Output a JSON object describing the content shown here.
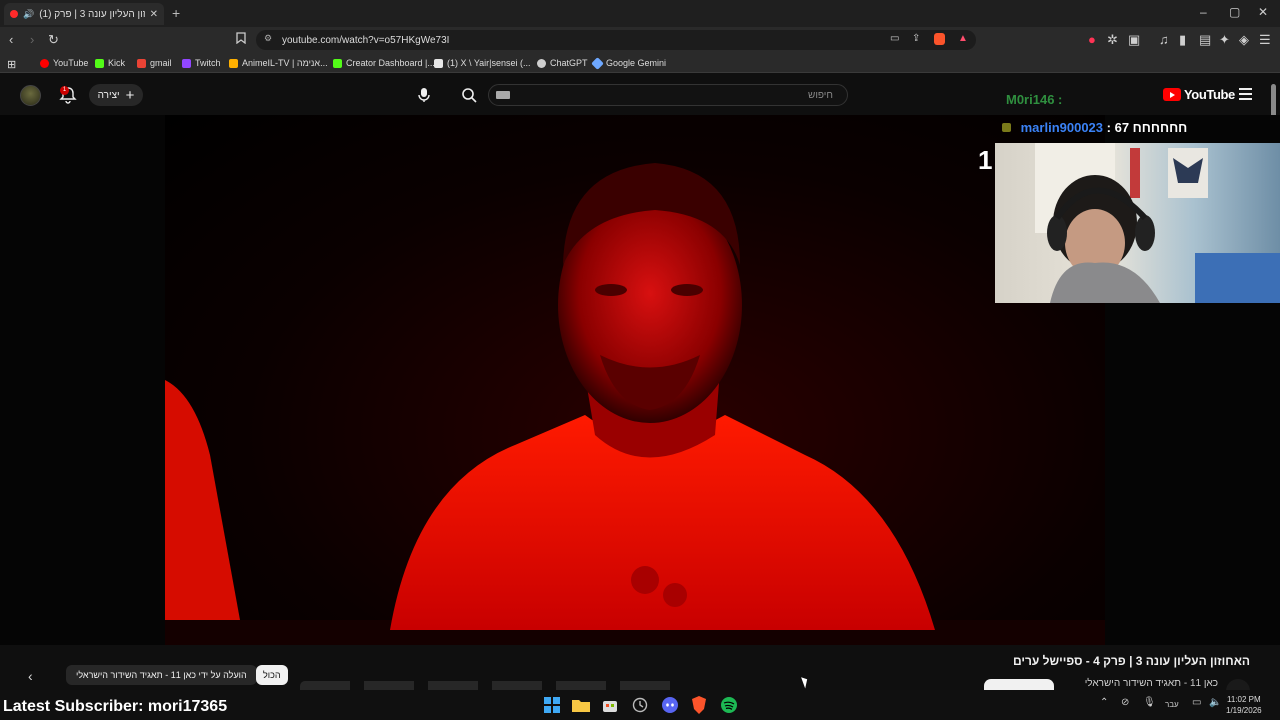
{
  "browser": {
    "tab_title": "(1) האחוזון העליון עונה 3 | פרק",
    "new_tab": "+",
    "url": "youtube.com/watch?v=o57HKgWe73I",
    "window_controls": [
      "–",
      "▢",
      "✕"
    ],
    "bookmarks": [
      {
        "label": "YouTube",
        "color": "#ff0000"
      },
      {
        "label": "Kick",
        "color": "#53fc18"
      },
      {
        "label": "gmail",
        "color": "#ea4335"
      },
      {
        "label": "Twitch",
        "color": "#9146ff"
      },
      {
        "label": "AnimeIL-TV | אנימה...",
        "color": "#ffb000"
      },
      {
        "label": "Creator Dashboard |...",
        "color": "#53fc18"
      },
      {
        "label": "(1) X \\ Yair|sensei (...",
        "color": "#e7e7e7"
      },
      {
        "label": "ChatGPT",
        "color": "#cfcfcf"
      },
      {
        "label": "Google Gemini",
        "color": "#6ea8ff"
      }
    ]
  },
  "youtube": {
    "logo_text": "YouTube",
    "search_placeholder": "חיפוש",
    "create_label": "יצירה",
    "notification_count": "1"
  },
  "overlay": {
    "chat": [
      {
        "user": "M0ri146 :",
        "user_color": "#3fb950",
        "text": ""
      },
      {
        "user": "marlin900023",
        "user_color": "#3b82f6",
        "text": ": 67 חחחחחח"
      }
    ],
    "counter": "1"
  },
  "video": {
    "title": "האחוזון העליון עונה 3 | פרק 4 - ספיישל ערים",
    "channel": "כאן 11 - תאגיד השידור הישראלי"
  },
  "chips": {
    "all": "הכול",
    "uploaded_by": "הועלה על ידי כאן 11 - תאגיד השידור הישראלי"
  },
  "stream": {
    "latest_subscriber": "Latest Subscriber: mori17365"
  },
  "taskbar": {
    "language": "עבר",
    "time": "11:02 PM",
    "date": "1/19/2026"
  }
}
